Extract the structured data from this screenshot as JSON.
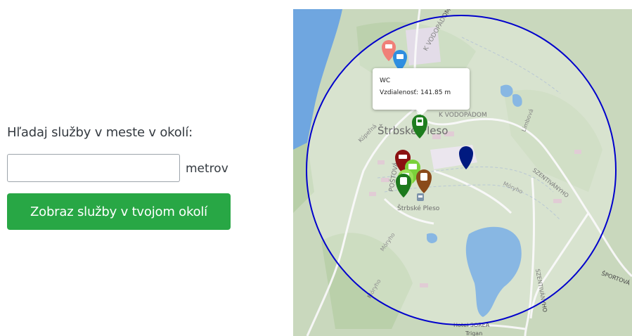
{
  "form": {
    "label": "Hľadaj služby v meste v okolí:",
    "input_value": "",
    "input_placeholder": "",
    "unit": "metrov",
    "button_label": "Zobraz služby v tvojom okolí"
  },
  "map": {
    "place_label": "Štrbské Pleso",
    "station_label": "Štrbské Pleso",
    "streets": {
      "k_vodopadom_north": "K VODOPÁDOM",
      "k_vodopadom": "K VODOPÁDOM",
      "postova": "POŠTOVÁ",
      "kupelna": "Kúpeľná",
      "limbova": "Limbová",
      "szentivanyho_east": "SZENTIVÁNYHO",
      "szentivanyho_south": "SZENTIVÁNYHO",
      "sportova": "ŠPORTOVÁ",
      "moryho_east": "Móryho",
      "moryho_west": "Móryho",
      "moryho_south": "Móryho"
    },
    "poi_labels": {
      "hotel": "Hotel SOREA",
      "trigan": "Trigan"
    },
    "popup": {
      "title": "WC",
      "distance": "Vzdialenosť: 141.85 m"
    },
    "colors": {
      "search_circle": "#0000cc",
      "user_marker": "#001a80",
      "wc_marker": "#1e7d1e",
      "accommodation_marker_light": "#f08078",
      "atm_marker": "#2f8ee0",
      "accommodation_marker_dark": "#8b1111",
      "station_marker": "#7bd13a",
      "fuel_marker": "#1d7a1d",
      "restaurant_marker": "#8a4a1a"
    }
  }
}
